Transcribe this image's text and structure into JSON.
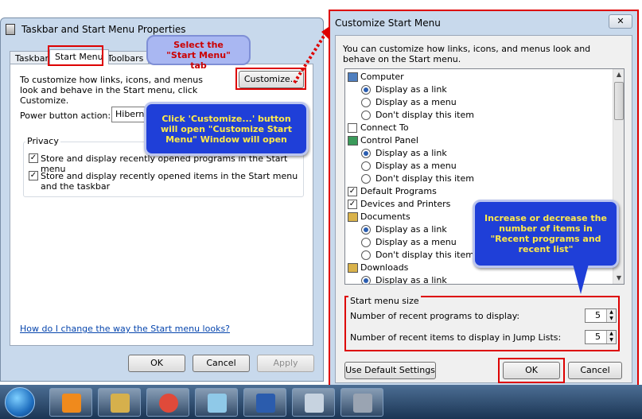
{
  "left_window": {
    "title": "Taskbar and Start Menu Properties",
    "tabs": [
      {
        "label": "Taskbar",
        "active": false
      },
      {
        "label": "Start Menu",
        "active": true
      },
      {
        "label": "Toolbars",
        "active": false
      }
    ],
    "intro_text": "To customize how links, icons, and menus look and behave in the Start menu, click Customize.",
    "customize_button": "Customize...",
    "power_button_label": "Power button action:",
    "power_button_value": "Hibernate",
    "privacy": {
      "title": "Privacy",
      "items": [
        {
          "label": "Store and display recently opened programs in the Start menu",
          "checked": true
        },
        {
          "label": "Store and display recently opened items in the Start menu and the taskbar",
          "checked": true
        }
      ]
    },
    "help_link": "How do I change the way the Start menu looks?",
    "buttons": {
      "ok": "OK",
      "cancel": "Cancel",
      "apply": "Apply"
    }
  },
  "right_window": {
    "title": "Customize Start Menu",
    "close_glyph": "✕",
    "description": "You can customize how links, icons, and menus look and behave on the Start menu.",
    "list_items": [
      {
        "kind": "header",
        "label": "Computer",
        "icon": "computer-icon"
      },
      {
        "kind": "radio",
        "label": "Display as a link",
        "selected": true
      },
      {
        "kind": "radio",
        "label": "Display as a menu",
        "selected": false
      },
      {
        "kind": "radio",
        "label": "Don't display this item",
        "selected": false
      },
      {
        "kind": "checkbox",
        "label": "Connect To",
        "checked": false
      },
      {
        "kind": "header",
        "label": "Control Panel",
        "icon": "control-panel-icon"
      },
      {
        "kind": "radio",
        "label": "Display as a link",
        "selected": true
      },
      {
        "kind": "radio",
        "label": "Display as a menu",
        "selected": false
      },
      {
        "kind": "radio",
        "label": "Don't display this item",
        "selected": false
      },
      {
        "kind": "checkbox",
        "label": "Default Programs",
        "checked": true
      },
      {
        "kind": "checkbox",
        "label": "Devices and Printers",
        "checked": true
      },
      {
        "kind": "header",
        "label": "Documents",
        "icon": "documents-icon"
      },
      {
        "kind": "radio",
        "label": "Display as a link",
        "selected": true
      },
      {
        "kind": "radio",
        "label": "Display as a menu",
        "selected": false
      },
      {
        "kind": "radio",
        "label": "Don't display this item",
        "selected": false
      },
      {
        "kind": "header",
        "label": "Downloads",
        "icon": "downloads-icon"
      },
      {
        "kind": "radio",
        "label": "Display as a link",
        "selected": true
      }
    ],
    "start_menu_size": {
      "title": "Start menu size",
      "recent_programs_label": "Number of recent programs to display:",
      "recent_programs_value": "5",
      "recent_items_label": "Number of recent items to display in Jump Lists:",
      "recent_items_value": "5"
    },
    "buttons": {
      "defaults": "Use Default Settings",
      "ok": "OK",
      "cancel": "Cancel"
    }
  },
  "annotations": {
    "select_tab": "Select the \"Start Menu\" tab",
    "customize_note": "Click 'Customize...' button will open \"Customize Start Menu\" Window will open",
    "increase_note": "Increase or decrease the number of items in \"Recent programs and recent list\""
  },
  "colors": {
    "annotation_red": "#dd0000",
    "callout_blue": "#1f3fd8",
    "callout_text_yellow": "#ffe94a",
    "window_frame": "#c8d9ec",
    "taskbar": "#2b4a6f"
  },
  "taskbar": {
    "items": [
      "media-player-icon",
      "explorer-icon",
      "chrome-icon",
      "notepad-icon",
      "word-icon",
      "cut-tool-icon",
      "server-icon"
    ]
  }
}
